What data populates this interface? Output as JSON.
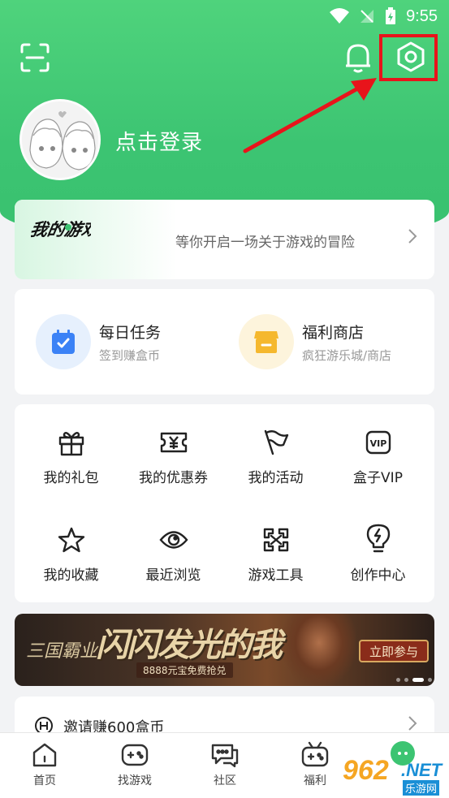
{
  "status_bar": {
    "time": "9:55"
  },
  "profile": {
    "login_text": "点击登录"
  },
  "banner": {
    "text": "等你开启一场关于游戏的冒险",
    "logo_text": "我的游戏"
  },
  "tasks": [
    {
      "title": "每日任务",
      "subtitle": "签到赚盒币",
      "icon": "calendar-check-icon",
      "color": "#3b82f6"
    },
    {
      "title": "福利商店",
      "subtitle": "疯狂游乐城/商店",
      "icon": "store-icon",
      "color": "#f5b82e"
    }
  ],
  "grid": [
    {
      "label": "我的礼包",
      "icon": "gift-icon"
    },
    {
      "label": "我的优惠券",
      "icon": "coupon-icon"
    },
    {
      "label": "我的活动",
      "icon": "flag-icon"
    },
    {
      "label": "盒子VIP",
      "icon": "vip-icon"
    },
    {
      "label": "我的收藏",
      "icon": "star-icon"
    },
    {
      "label": "最近浏览",
      "icon": "eye-icon"
    },
    {
      "label": "游戏工具",
      "icon": "tools-icon"
    },
    {
      "label": "创作中心",
      "icon": "lightbulb-icon"
    }
  ],
  "ad": {
    "game_title": "三国霸业",
    "headline": "闪闪发光的我",
    "promo": "8888元宝免费抢兑",
    "cta": "立即参与"
  },
  "invite": {
    "text": "邀请赚600盒币"
  },
  "nav": [
    {
      "label": "首页",
      "icon": "home-icon"
    },
    {
      "label": "找游戏",
      "icon": "gamepad-icon"
    },
    {
      "label": "社区",
      "icon": "chat-icon"
    },
    {
      "label": "福利",
      "icon": "gift-tv-icon"
    }
  ],
  "watermark": {
    "number": "962",
    "suffix": ".NET",
    "sub": "乐游网"
  },
  "colors": {
    "brand_green": "#3cc472",
    "highlight_red": "#e8141b"
  }
}
